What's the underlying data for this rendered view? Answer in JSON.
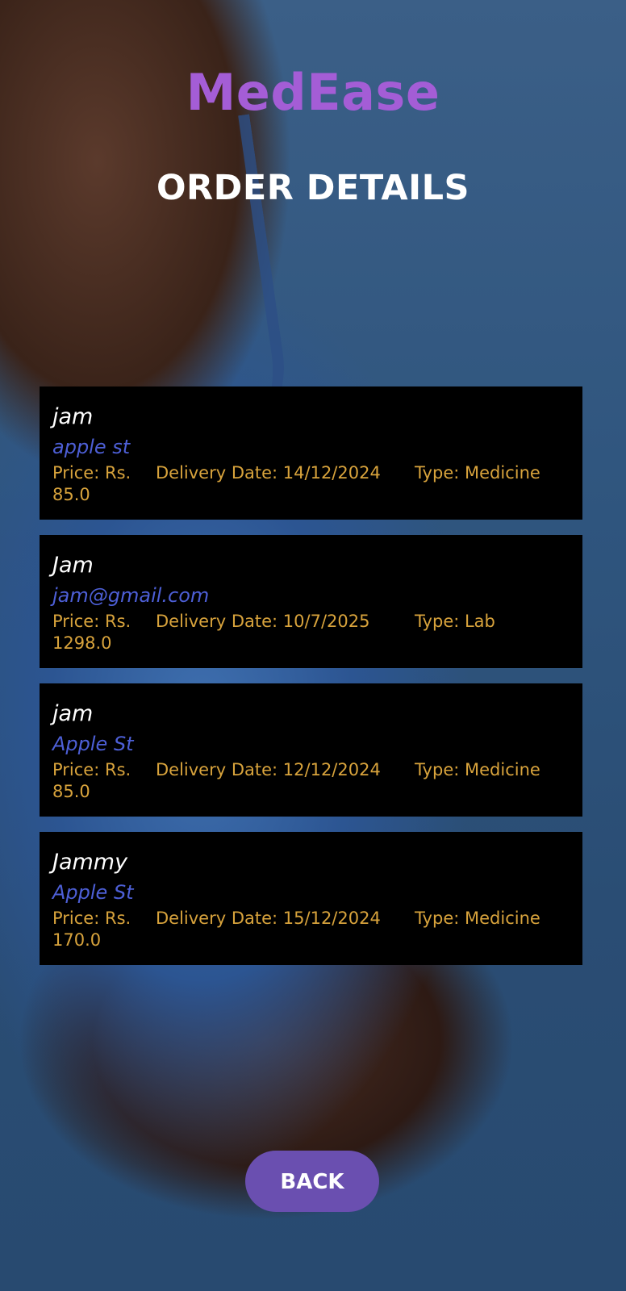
{
  "app": {
    "title": "MedEase"
  },
  "page": {
    "title": "ORDER DETAILS"
  },
  "orders": [
    {
      "name": "jam",
      "address": "apple st",
      "price_label": "Price: Rs.",
      "price": "85.0",
      "delivery_date": "Delivery Date: 14/12/2024",
      "type": "Type: Medicine"
    },
    {
      "name": "Jam",
      "address": "jam@gmail.com",
      "price_label": "Price: Rs.",
      "price": "1298.0",
      "delivery_date": "Delivery Date: 10/7/2025",
      "type": "Type: Lab"
    },
    {
      "name": "jam",
      "address": "Apple St",
      "price_label": "Price: Rs.",
      "price": "85.0",
      "delivery_date": "Delivery Date: 12/12/2024",
      "type": "Type: Medicine"
    },
    {
      "name": "Jammy",
      "address": "Apple St",
      "price_label": "Price: Rs.",
      "price": "170.0",
      "delivery_date": "Delivery Date: 15/12/2024",
      "type": "Type: Medicine"
    }
  ],
  "actions": {
    "back_label": "BACK"
  },
  "colors": {
    "brand": "#a45dd6",
    "button": "#6a4fb0",
    "address": "#4d5fd6",
    "meta": "#d8a33c",
    "card": "#000000"
  }
}
